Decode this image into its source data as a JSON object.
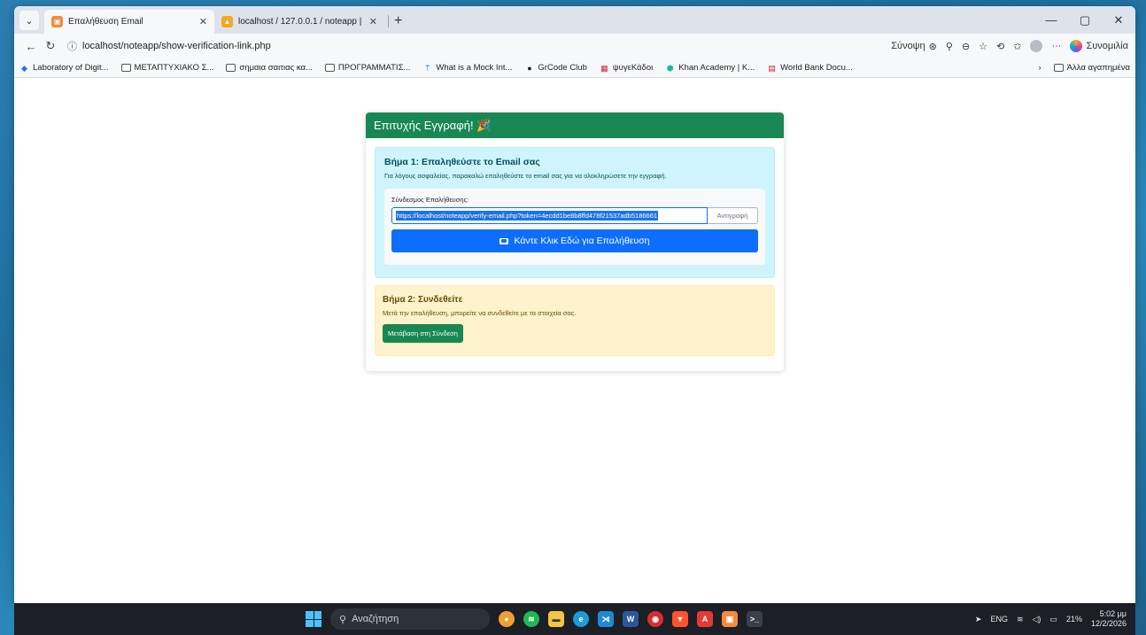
{
  "browser": {
    "tabs": [
      {
        "title": "Επαλήθευση Email",
        "favicon_color": "#f28b3c",
        "active": true
      },
      {
        "title": "localhost / 127.0.0.1 / noteapp | ph",
        "favicon_color": "#f5a623",
        "active": false
      }
    ],
    "address": "localhost/noteapp/show-verification-link.php",
    "sync_label": "Σύνοψη",
    "copilot_label": "Συνομιλία"
  },
  "bookmarks": [
    {
      "label": "Laboratory of Digit...",
      "icon": "diamond-icon"
    },
    {
      "label": "ΜΕΤΑΠΤΥΧΙΑΚΟ Σ...",
      "icon": "folder-icon"
    },
    {
      "label": "σημαια σαιτιας κα...",
      "icon": "folder-icon"
    },
    {
      "label": "ΠΡΟΓΡΑΜΜΑΤΙΣ...",
      "icon": "folder-icon"
    },
    {
      "label": "What is a Mock Int...",
      "icon": "pin-icon"
    },
    {
      "label": "GrCode Club",
      "icon": "circle-icon"
    },
    {
      "label": "ψυγεΚάδοι",
      "icon": "grid-icon"
    },
    {
      "label": "Khan Academy | K...",
      "icon": "khan-icon"
    },
    {
      "label": "World Bank Docu...",
      "icon": "pdf-icon"
    }
  ],
  "bookmarks_other": "Άλλα αγαπημένα",
  "card": {
    "header": "Επιτυχής Εγγραφή! 🎉",
    "step1_title": "Βήμα 1: Επαληθεύστε το Email σας",
    "step1_text": "Για λόγους ασφαλείας, παρακαλώ επαληθεύστε το email σας για να ολοκληρώσετε την εγγραφή.",
    "link_label": "Σύνδεσμος Επαλήθευσης:",
    "link_value": "https://localhost/noteapp/verify-email.php?token=4ecdd1be8b8ffd478f21537adb5186661",
    "copy_label": "Αντιγραφή",
    "verify_button": "Κάντε Κλικ Εδώ για Επαλήθευση",
    "step2_title": "Βήμα 2: Συνδεθείτε",
    "step2_text": "Μετά την επαλήθευση, μπορείτε να συνδεθείτε με τα στοιχεία σας.",
    "login_button": "Μετάβαση στη Σύνδεση"
  },
  "taskbar": {
    "search_placeholder": "Αναζήτηση",
    "lang": "ENG",
    "battery": "21%",
    "time": "5:02 μμ",
    "date": "12/2/2026"
  },
  "colors": {
    "success": "#198754",
    "primary": "#0d6efd",
    "info_bg": "#cff4fc",
    "warning_bg": "#fff3cd"
  }
}
